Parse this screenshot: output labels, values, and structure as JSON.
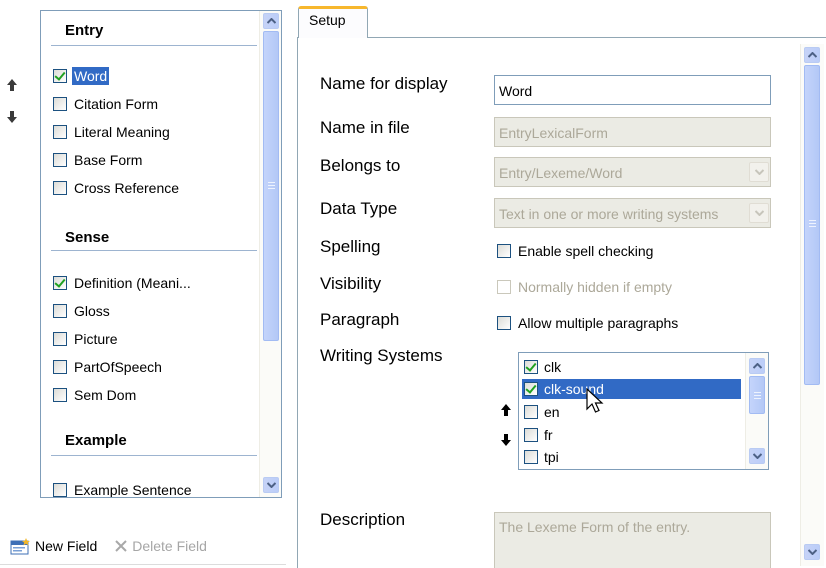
{
  "field_list": {
    "groups": [
      {
        "header": "Entry",
        "items": [
          {
            "label": "Word",
            "checked": true,
            "selected": true
          },
          {
            "label": "Citation Form",
            "checked": false
          },
          {
            "label": "Literal Meaning",
            "checked": false
          },
          {
            "label": "Base Form",
            "checked": false
          },
          {
            "label": "Cross Reference",
            "checked": false
          }
        ]
      },
      {
        "header": "Sense",
        "items": [
          {
            "label": "Definition (Meani...",
            "checked": true
          },
          {
            "label": "Gloss",
            "checked": false
          },
          {
            "label": "Picture",
            "checked": false
          },
          {
            "label": "PartOfSpeech",
            "checked": false
          },
          {
            "label": "Sem Dom",
            "checked": false
          }
        ]
      },
      {
        "header": "Example",
        "items": [
          {
            "label": "Example Sentence",
            "checked": false
          }
        ]
      }
    ]
  },
  "move_buttons": {
    "up_icon": "arrow-up-icon",
    "down_icon": "arrow-down-icon"
  },
  "toolbar": {
    "new_field": "New Field",
    "delete_field": "Delete Field"
  },
  "tabs": [
    {
      "label": "Setup",
      "active": true
    }
  ],
  "setup": {
    "name_for_display": {
      "label": "Name for display",
      "value": "Word"
    },
    "name_in_file": {
      "label": "Name in file",
      "value": "EntryLexicalForm"
    },
    "belongs_to": {
      "label": "Belongs to",
      "value": "Entry/Lexeme/Word"
    },
    "data_type": {
      "label": "Data Type",
      "value": "Text in one or more writing systems"
    },
    "spelling": {
      "label": "Spelling",
      "checkbox": "Enable spell checking",
      "checked": false
    },
    "visibility": {
      "label": "Visibility",
      "checkbox": "Normally hidden if empty",
      "checked": false,
      "enabled": false
    },
    "paragraph": {
      "label": "Paragraph",
      "checkbox": "Allow multiple paragraphs",
      "checked": false
    },
    "writing_systems": {
      "label": "Writing Systems",
      "items": [
        {
          "label": "clk",
          "checked": true
        },
        {
          "label": "clk-sound",
          "checked": true,
          "selected": true
        },
        {
          "label": "en",
          "checked": false
        },
        {
          "label": "fr",
          "checked": false
        },
        {
          "label": "tpi",
          "checked": false
        }
      ]
    },
    "description": {
      "label": "Description",
      "value": "The Lexeme Form of the entry."
    }
  },
  "colors": {
    "selection": "#316ac5",
    "tab_accent": "#f7b72d",
    "check_mark": "#21a121",
    "border": "#7f9db9"
  }
}
